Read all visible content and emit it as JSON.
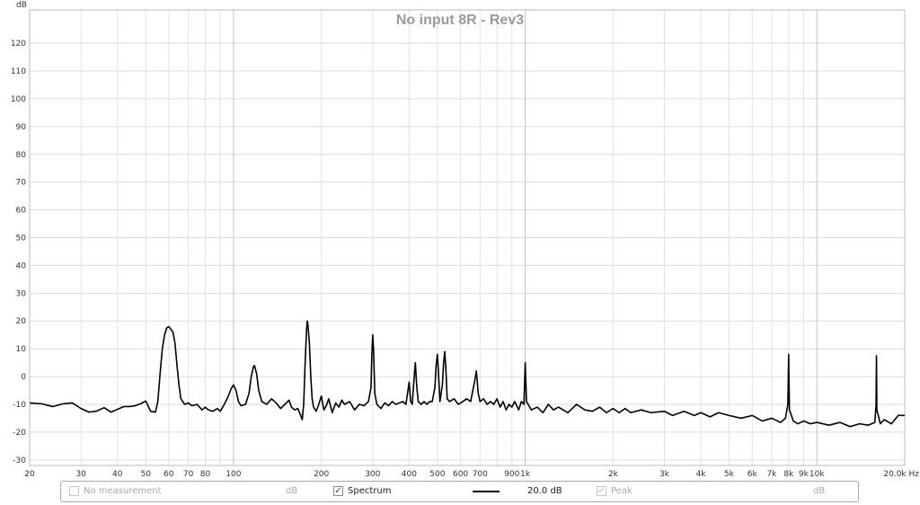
{
  "chart_data": {
    "type": "line",
    "title": "No input 8R - Rev3",
    "ylabel": "dB",
    "xlabel": "",
    "x_unit": "Hz",
    "x_scale": "log",
    "xlim": [
      20,
      20000
    ],
    "ylim": [
      -32,
      132
    ],
    "grid": true,
    "y_ticks": [
      120,
      110,
      100,
      90,
      80,
      70,
      60,
      50,
      40,
      30,
      20,
      10,
      0,
      -10,
      -20,
      -30
    ],
    "y_tick_labels": [
      "120",
      "110",
      "100",
      "90",
      "80",
      "70",
      "60",
      "50",
      "40",
      "30",
      "20",
      "10",
      "0",
      "-10",
      "-20",
      "-30"
    ],
    "x_ticks": [
      20,
      30,
      40,
      50,
      60,
      70,
      80,
      100,
      200,
      300,
      400,
      500,
      600,
      700,
      900,
      1000,
      2000,
      3000,
      4000,
      5000,
      6000,
      7000,
      8000,
      9000,
      10000,
      20000
    ],
    "x_tick_labels": [
      "20",
      "30",
      "40",
      "50",
      "60",
      "70",
      "80",
      "100",
      "200",
      "300",
      "400",
      "500",
      "600",
      "700",
      "900",
      "1k",
      "2k",
      "3k",
      "4k",
      "5k",
      "6k",
      "7k",
      "8k",
      "9k",
      "10k",
      "20.0k Hz"
    ],
    "series": [
      {
        "name": "Spectrum",
        "color": "#000000",
        "points": [
          [
            20,
            -9.5
          ],
          [
            22,
            -9.8
          ],
          [
            24,
            -10.8
          ],
          [
            26,
            -9.8
          ],
          [
            28,
            -9.5
          ],
          [
            30,
            -11.5
          ],
          [
            32,
            -12.8
          ],
          [
            34,
            -12.4
          ],
          [
            36,
            -11.2
          ],
          [
            38,
            -12.8
          ],
          [
            40,
            -11.8
          ],
          [
            42,
            -10.8
          ],
          [
            44,
            -10.8
          ],
          [
            46,
            -10.5
          ],
          [
            48,
            -9.8
          ],
          [
            50,
            -8.8
          ],
          [
            52,
            -12.5
          ],
          [
            54,
            -12.8
          ],
          [
            55,
            -9
          ],
          [
            56,
            1
          ],
          [
            57,
            10
          ],
          [
            58,
            15
          ],
          [
            59,
            17.5
          ],
          [
            60,
            18
          ],
          [
            61,
            17
          ],
          [
            62,
            16
          ],
          [
            63,
            12
          ],
          [
            64,
            4
          ],
          [
            65,
            -3
          ],
          [
            66,
            -8
          ],
          [
            68,
            -10
          ],
          [
            70,
            -9.5
          ],
          [
            72,
            -10.5
          ],
          [
            75,
            -10
          ],
          [
            78,
            -12
          ],
          [
            80,
            -11
          ],
          [
            82,
            -12
          ],
          [
            85,
            -12.5
          ],
          [
            88,
            -11.5
          ],
          [
            90,
            -12.5
          ],
          [
            93,
            -10
          ],
          [
            96,
            -7
          ],
          [
            98,
            -4.5
          ],
          [
            100,
            -3
          ],
          [
            102,
            -5
          ],
          [
            104,
            -9
          ],
          [
            106,
            -10.5
          ],
          [
            110,
            -10
          ],
          [
            113,
            -6
          ],
          [
            115,
            0
          ],
          [
            117,
            3.5
          ],
          [
            118,
            4
          ],
          [
            120,
            1
          ],
          [
            122,
            -5
          ],
          [
            125,
            -9
          ],
          [
            130,
            -10
          ],
          [
            135,
            -8
          ],
          [
            140,
            -9.5
          ],
          [
            145,
            -11.5
          ],
          [
            150,
            -10
          ],
          [
            155,
            -8.5
          ],
          [
            158,
            -11
          ],
          [
            162,
            -12
          ],
          [
            166,
            -11.5
          ],
          [
            170,
            -14
          ],
          [
            172,
            -15.5
          ],
          [
            174,
            -10
          ],
          [
            176,
            5
          ],
          [
            178,
            17
          ],
          [
            179,
            20
          ],
          [
            180,
            18.5
          ],
          [
            182,
            12
          ],
          [
            184,
            0
          ],
          [
            186,
            -8
          ],
          [
            188,
            -11
          ],
          [
            192,
            -12.5
          ],
          [
            196,
            -10
          ],
          [
            200,
            -7
          ],
          [
            204,
            -12
          ],
          [
            208,
            -10.5
          ],
          [
            212,
            -8
          ],
          [
            218,
            -13
          ],
          [
            224,
            -9.5
          ],
          [
            230,
            -11
          ],
          [
            235,
            -8.5
          ],
          [
            240,
            -10
          ],
          [
            250,
            -9
          ],
          [
            260,
            -12
          ],
          [
            270,
            -10
          ],
          [
            280,
            -10.5
          ],
          [
            290,
            -9
          ],
          [
            296,
            -4
          ],
          [
            298,
            8
          ],
          [
            300,
            15
          ],
          [
            302,
            10
          ],
          [
            305,
            -6
          ],
          [
            310,
            -10
          ],
          [
            320,
            -11.5
          ],
          [
            330,
            -9.5
          ],
          [
            340,
            -10.5
          ],
          [
            350,
            -9
          ],
          [
            360,
            -10
          ],
          [
            370,
            -9.5
          ],
          [
            380,
            -9
          ],
          [
            390,
            -10
          ],
          [
            395,
            -6
          ],
          [
            400,
            -2
          ],
          [
            405,
            -9
          ],
          [
            410,
            -10
          ],
          [
            415,
            -2
          ],
          [
            420,
            5
          ],
          [
            425,
            -4
          ],
          [
            430,
            -9
          ],
          [
            440,
            -10
          ],
          [
            450,
            -9
          ],
          [
            460,
            -10
          ],
          [
            470,
            -9
          ],
          [
            480,
            -9
          ],
          [
            490,
            -4
          ],
          [
            495,
            4
          ],
          [
            500,
            8
          ],
          [
            505,
            0
          ],
          [
            510,
            -9
          ],
          [
            520,
            -3
          ],
          [
            525,
            5
          ],
          [
            530,
            9
          ],
          [
            535,
            2
          ],
          [
            540,
            -8
          ],
          [
            550,
            -9
          ],
          [
            570,
            -8
          ],
          [
            590,
            -10
          ],
          [
            610,
            -9
          ],
          [
            630,
            -8
          ],
          [
            650,
            -9
          ],
          [
            670,
            -2
          ],
          [
            680,
            2
          ],
          [
            690,
            -6
          ],
          [
            700,
            -9
          ],
          [
            720,
            -8
          ],
          [
            740,
            -10
          ],
          [
            760,
            -9
          ],
          [
            780,
            -10
          ],
          [
            800,
            -8
          ],
          [
            820,
            -11
          ],
          [
            840,
            -9
          ],
          [
            860,
            -12
          ],
          [
            880,
            -10
          ],
          [
            900,
            -11
          ],
          [
            920,
            -9
          ],
          [
            950,
            -12
          ],
          [
            970,
            -9
          ],
          [
            990,
            -10
          ],
          [
            1000,
            5
          ],
          [
            1010,
            -9
          ],
          [
            1050,
            -12
          ],
          [
            1100,
            -11
          ],
          [
            1150,
            -13
          ],
          [
            1200,
            -10
          ],
          [
            1250,
            -12
          ],
          [
            1300,
            -11
          ],
          [
            1400,
            -13
          ],
          [
            1500,
            -10
          ],
          [
            1600,
            -12
          ],
          [
            1700,
            -12.5
          ],
          [
            1800,
            -11
          ],
          [
            1900,
            -13
          ],
          [
            2000,
            -11.5
          ],
          [
            2100,
            -13
          ],
          [
            2200,
            -11.5
          ],
          [
            2300,
            -13
          ],
          [
            2500,
            -12
          ],
          [
            2700,
            -13
          ],
          [
            3000,
            -12.5
          ],
          [
            3200,
            -14
          ],
          [
            3500,
            -12.5
          ],
          [
            3800,
            -14
          ],
          [
            4000,
            -13
          ],
          [
            4300,
            -14.5
          ],
          [
            4600,
            -13
          ],
          [
            5000,
            -14
          ],
          [
            5500,
            -15
          ],
          [
            6000,
            -14
          ],
          [
            6500,
            -16
          ],
          [
            7000,
            -15
          ],
          [
            7500,
            -16.5
          ],
          [
            7800,
            -15
          ],
          [
            7950,
            -10
          ],
          [
            8000,
            8
          ],
          [
            8050,
            -12
          ],
          [
            8300,
            -16
          ],
          [
            8600,
            -17
          ],
          [
            9000,
            -16
          ],
          [
            9500,
            -17
          ],
          [
            10000,
            -16.5
          ],
          [
            11000,
            -17.5
          ],
          [
            12000,
            -16.5
          ],
          [
            13000,
            -18
          ],
          [
            14000,
            -17
          ],
          [
            15000,
            -17.5
          ],
          [
            15800,
            -16.5
          ],
          [
            15950,
            -10
          ],
          [
            16000,
            7.5
          ],
          [
            16050,
            -12
          ],
          [
            16500,
            -17
          ],
          [
            17000,
            -15.5
          ],
          [
            18000,
            -17
          ],
          [
            19000,
            -14
          ],
          [
            20000,
            -14
          ]
        ]
      }
    ]
  },
  "legend": {
    "no_measurement": {
      "label": "No measurement",
      "unit": "dB",
      "checked": false
    },
    "spectrum": {
      "label": "Spectrum",
      "offset": "20.0 dB",
      "checked": true,
      "check_glyph": "✓"
    },
    "peak": {
      "label": "Peak",
      "unit": "dB",
      "checked": true,
      "check_glyph": "✓"
    }
  }
}
